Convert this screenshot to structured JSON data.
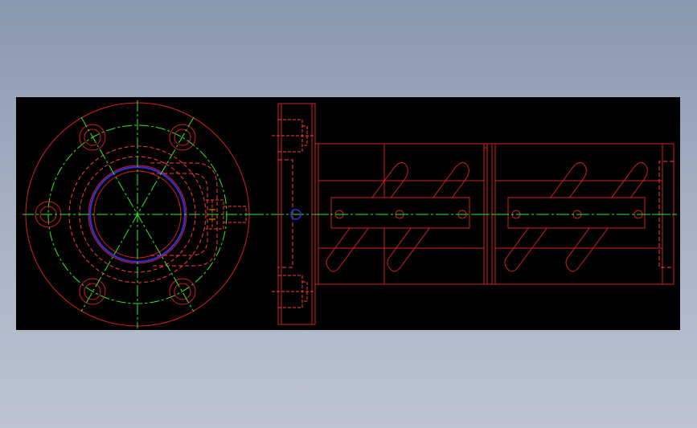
{
  "colors": {
    "background_top": "#8898ae",
    "background_bottom": "#bcc4d2",
    "canvas": "#000000",
    "outline": "#d42020",
    "hidden_line": "#ff3a3a",
    "centerline": "#2eea2e",
    "highlight_circle": "#3030d8"
  },
  "views": {
    "front_view": {
      "label": "flange-end-view",
      "bolt_holes": 6
    },
    "side_view": {
      "label": "nut-side-section",
      "nut_bodies": 2,
      "thread_segments": 4
    }
  }
}
